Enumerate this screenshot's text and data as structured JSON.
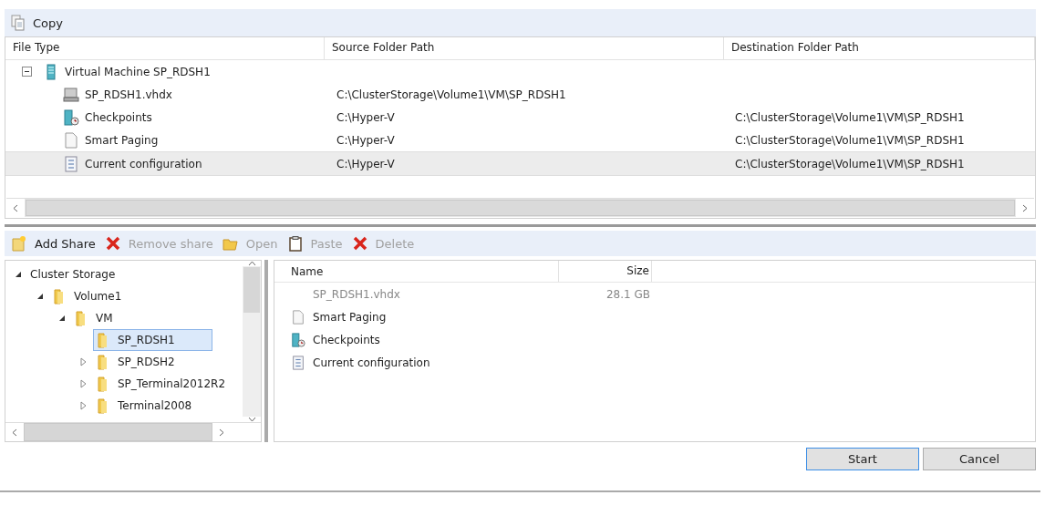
{
  "top_toolbar": {
    "label": "Copy"
  },
  "table": {
    "columns": [
      "File Type",
      "Source Folder Path",
      "Destination Folder Path"
    ],
    "rows": [
      {
        "kind": "machine",
        "name": "Virtual Machine SP_RDSH1",
        "expanded": true,
        "selected": false
      },
      {
        "kind": "disk",
        "name": "SP_RDSH1.vhdx",
        "source": "C:\\ClusterStorage\\Volume1\\VM\\SP_RDSH1",
        "selected": false
      },
      {
        "kind": "checkpoint",
        "name": "Checkpoints",
        "source": "C:\\Hyper-V",
        "destination": "C:\\ClusterStorage\\Volume1\\VM\\SP_RDSH1",
        "selected": false
      },
      {
        "kind": "page",
        "name": "Smart Paging",
        "source": "C:\\Hyper-V",
        "destination": "C:\\ClusterStorage\\Volume1\\VM\\SP_RDSH1",
        "selected": false
      },
      {
        "kind": "config",
        "name": "Current configuration",
        "source": "C:\\Hyper-V",
        "destination": "C:\\ClusterStorage\\Volume1\\VM\\SP_RDSH1",
        "selected": true
      }
    ]
  },
  "share_toolbar": [
    {
      "kind": "add",
      "label": "Add Share",
      "disabled": false
    },
    {
      "kind": "remove",
      "label": "Remove share",
      "disabled": true
    },
    {
      "kind": "open",
      "label": "Open",
      "disabled": true
    },
    {
      "kind": "paste",
      "label": "Paste",
      "disabled": true
    },
    {
      "kind": "remove",
      "label": "Delete",
      "disabled": true
    }
  ],
  "tree": [
    {
      "label": "Cluster Storage",
      "expanded": true,
      "selected": false,
      "children": [
        {
          "label": "Volume1",
          "expanded": true,
          "selected": false,
          "children": [
            {
              "label": "VM",
              "expanded": true,
              "selected": false,
              "children": [
                {
                  "label": "SP_RDSH1",
                  "expanded": false,
                  "has_children": false,
                  "selected": true
                },
                {
                  "label": "SP_RDSH2",
                  "expanded": false,
                  "has_children": true,
                  "selected": false
                },
                {
                  "label": "SP_Terminal2012R2",
                  "expanded": false,
                  "has_children": true,
                  "selected": false
                },
                {
                  "label": "Terminal2008",
                  "expanded": false,
                  "has_children": true,
                  "selected": false
                }
              ]
            }
          ]
        }
      ]
    }
  ],
  "file_list": {
    "columns": [
      "Name",
      "Size"
    ],
    "items": [
      {
        "kind": "disk",
        "name": "SP_RDSH1.vhdx",
        "size": "28.1 GB",
        "disabled": true
      },
      {
        "kind": "page",
        "name": "Smart Paging",
        "disabled": false
      },
      {
        "kind": "checkpoint",
        "name": "Checkpoints",
        "disabled": false
      },
      {
        "kind": "config",
        "name": "Current configuration",
        "disabled": false
      }
    ]
  },
  "buttons": [
    {
      "label": "Start",
      "default": true
    },
    {
      "label": "Cancel",
      "default": false
    }
  ]
}
